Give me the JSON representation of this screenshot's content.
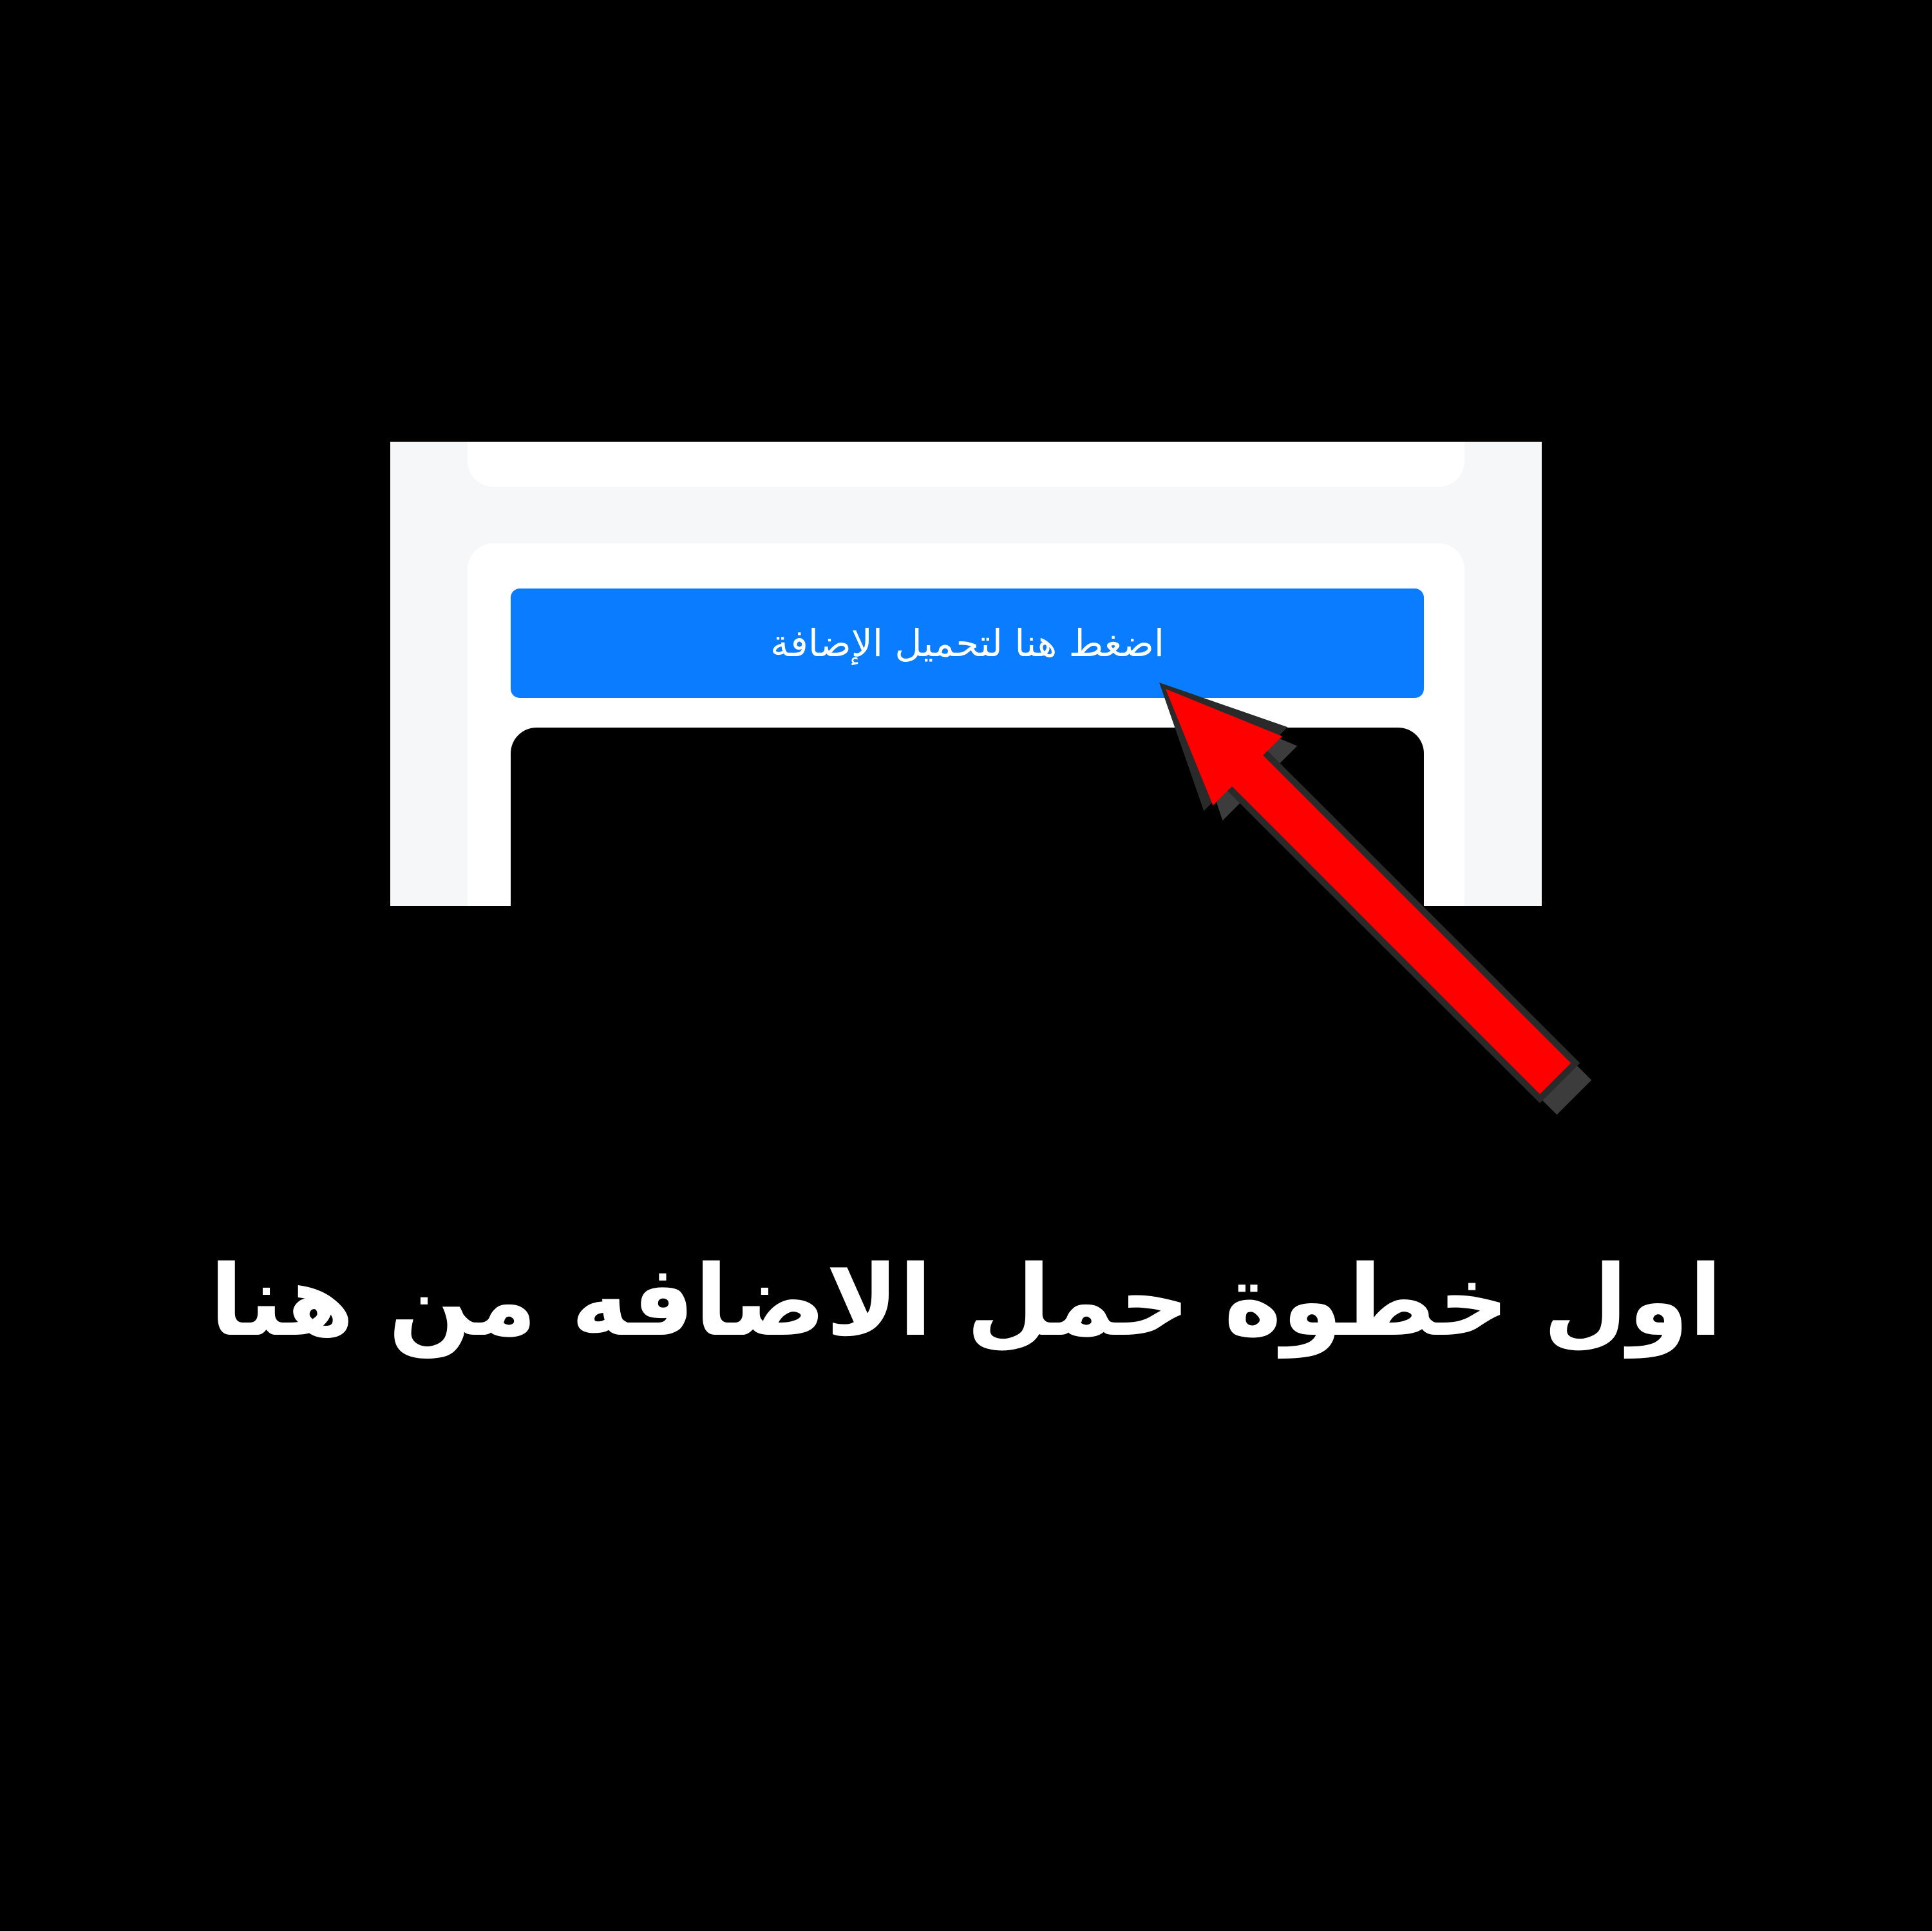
{
  "screenshot": {
    "download_button_label": "اضغط هنا لتحميل الإضافة"
  },
  "caption": {
    "text": "اول خطوة حمل الاضافه من هنا"
  },
  "colors": {
    "background": "#000000",
    "panel_background": "#f6f7f9",
    "card_background": "#ffffff",
    "button_blue": "#0a7cff",
    "arrow_red": "#ff0000",
    "caption_text": "#ffffff"
  },
  "icons": {
    "pointer": "red-arrow-icon"
  }
}
